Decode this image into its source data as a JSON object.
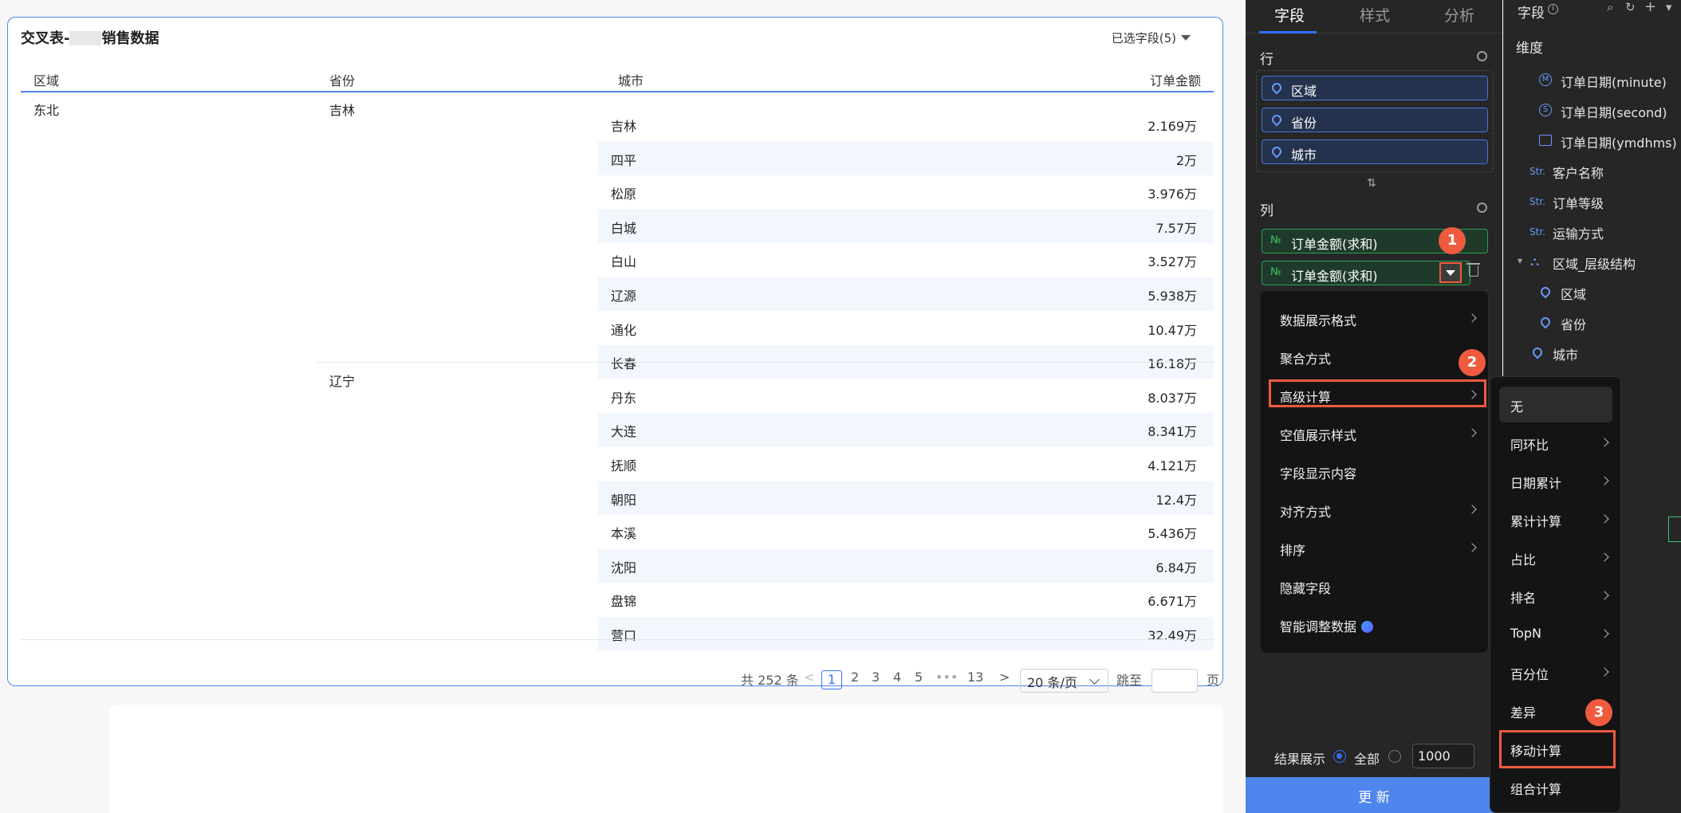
{
  "table": {
    "title_prefix": "交叉表-",
    "title_suffix": "销售数据",
    "selected_fields": "已选字段(5)",
    "headers": [
      "区域",
      "省份",
      "城市",
      "订单金额"
    ],
    "region": "东北",
    "provinces": [
      "吉林",
      "辽宁"
    ],
    "rows": [
      {
        "city": "吉林",
        "amount": "2.169万"
      },
      {
        "city": "四平",
        "amount": "2万"
      },
      {
        "city": "松原",
        "amount": "3.976万"
      },
      {
        "city": "白城",
        "amount": "7.57万"
      },
      {
        "city": "白山",
        "amount": "3.527万"
      },
      {
        "city": "辽源",
        "amount": "5.938万"
      },
      {
        "city": "通化",
        "amount": "10.47万"
      },
      {
        "city": "长春",
        "amount": "16.18万"
      },
      {
        "city": "丹东",
        "amount": "8.037万"
      },
      {
        "city": "大连",
        "amount": "8.341万"
      },
      {
        "city": "抚顺",
        "amount": "4.121万"
      },
      {
        "city": "朝阳",
        "amount": "12.4万"
      },
      {
        "city": "本溪",
        "amount": "5.436万"
      },
      {
        "city": "沈阳",
        "amount": "6.84万"
      },
      {
        "city": "盘锦",
        "amount": "6.671万"
      },
      {
        "city": "营口",
        "amount": "32.49万"
      }
    ]
  },
  "pagination": {
    "total": "共 252 条",
    "prev": "<",
    "pages": [
      "1",
      "2",
      "3",
      "4",
      "5",
      "•••",
      "13"
    ],
    "next": ">",
    "page_size": "20 条/页",
    "jump_label": "跳至",
    "jump_suffix": "页"
  },
  "config": {
    "tabs": [
      "字段",
      "样式",
      "分析"
    ],
    "rows_label": "行",
    "row_fields": [
      "区域",
      "省份",
      "城市"
    ],
    "swap": "⇅",
    "cols_label": "列",
    "col_fields": [
      "订单金额(求和)",
      "订单金额(求和)"
    ],
    "measure_prefix": "№",
    "result_label": "结果展示",
    "result_all": "全部",
    "result_limit": "1000",
    "update_button": "更 新"
  },
  "menu": {
    "items": [
      "数据展示格式",
      "聚合方式",
      "高级计算",
      "空值展示样式",
      "字段显示内容",
      "对齐方式",
      "排序",
      "隐藏字段",
      "智能调整数据"
    ],
    "submenu": [
      "无",
      "同环比",
      "日期累计",
      "累计计算",
      "占比",
      "排名",
      "TopN",
      "百分位",
      "差异",
      "移动计算",
      "组合计算"
    ]
  },
  "badges": [
    "1",
    "2",
    "3"
  ],
  "fields_panel": {
    "title": "字段",
    "info": "i",
    "dimension_label": "维度",
    "items": [
      "订单日期(minute)",
      "订单日期(second)",
      "订单日期(ymdhms)",
      "客户名称",
      "订单等级",
      "运输方式",
      "区域_层级结构",
      "区域",
      "省份",
      "城市"
    ],
    "minute_icon": "M",
    "second_icon": "S",
    "str_icon": "Str.",
    "hier_icon": "⛬",
    "tree_toggle": "▾",
    "search_icon": "⌕",
    "refresh_icon": "↻",
    "add_icon": "+",
    "more_icon": "▾"
  },
  "colors": {
    "accent": "#3370ff",
    "highlight": "#f05a3e",
    "panel": "#262626"
  }
}
